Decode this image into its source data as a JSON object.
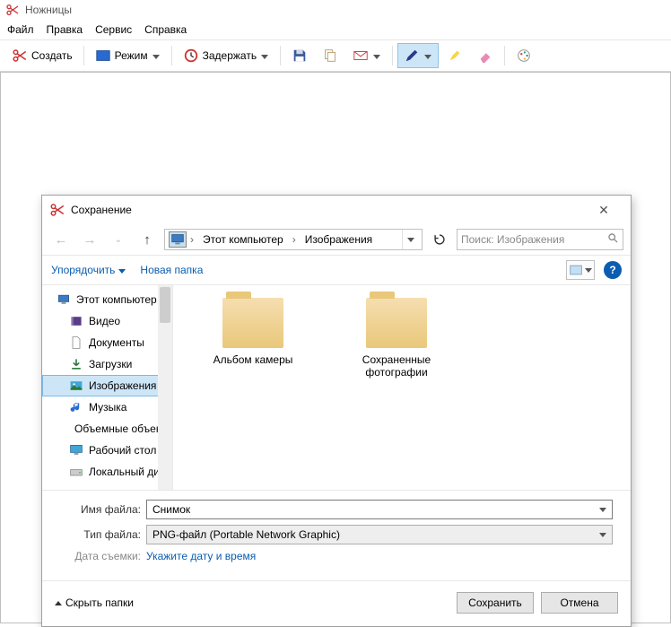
{
  "app": {
    "title": "Ножницы",
    "menu": [
      "Файл",
      "Правка",
      "Сервис",
      "Справка"
    ],
    "toolbar": {
      "new_label": "Создать",
      "mode_label": "Режим",
      "delay_label": "Задержать"
    }
  },
  "dialog": {
    "title": "Сохранение",
    "breadcrumb": {
      "root": "Этот компьютер",
      "folder": "Изображения"
    },
    "search_placeholder": "Поиск: Изображения",
    "organize_label": "Упорядочить",
    "newfolder_label": "Новая папка",
    "tree": {
      "root": "Этот компьютер",
      "items": [
        "Видео",
        "Документы",
        "Загрузки",
        "Изображения",
        "Музыка",
        "Объемные объекты",
        "Рабочий стол",
        "Локальный диск"
      ]
    },
    "folders": [
      {
        "name": "Альбом камеры"
      },
      {
        "name": "Сохраненные фотографии"
      }
    ],
    "form": {
      "filename_label": "Имя файла:",
      "filename_value": "Снимок",
      "filetype_label": "Тип файла:",
      "filetype_value": "PNG-файл (Portable Network Graphic)",
      "date_label": "Дата съемки:",
      "date_link": "Укажите дату и время"
    },
    "footer": {
      "hide_label": "Скрыть папки",
      "save_label": "Сохранить",
      "cancel_label": "Отмена"
    }
  }
}
